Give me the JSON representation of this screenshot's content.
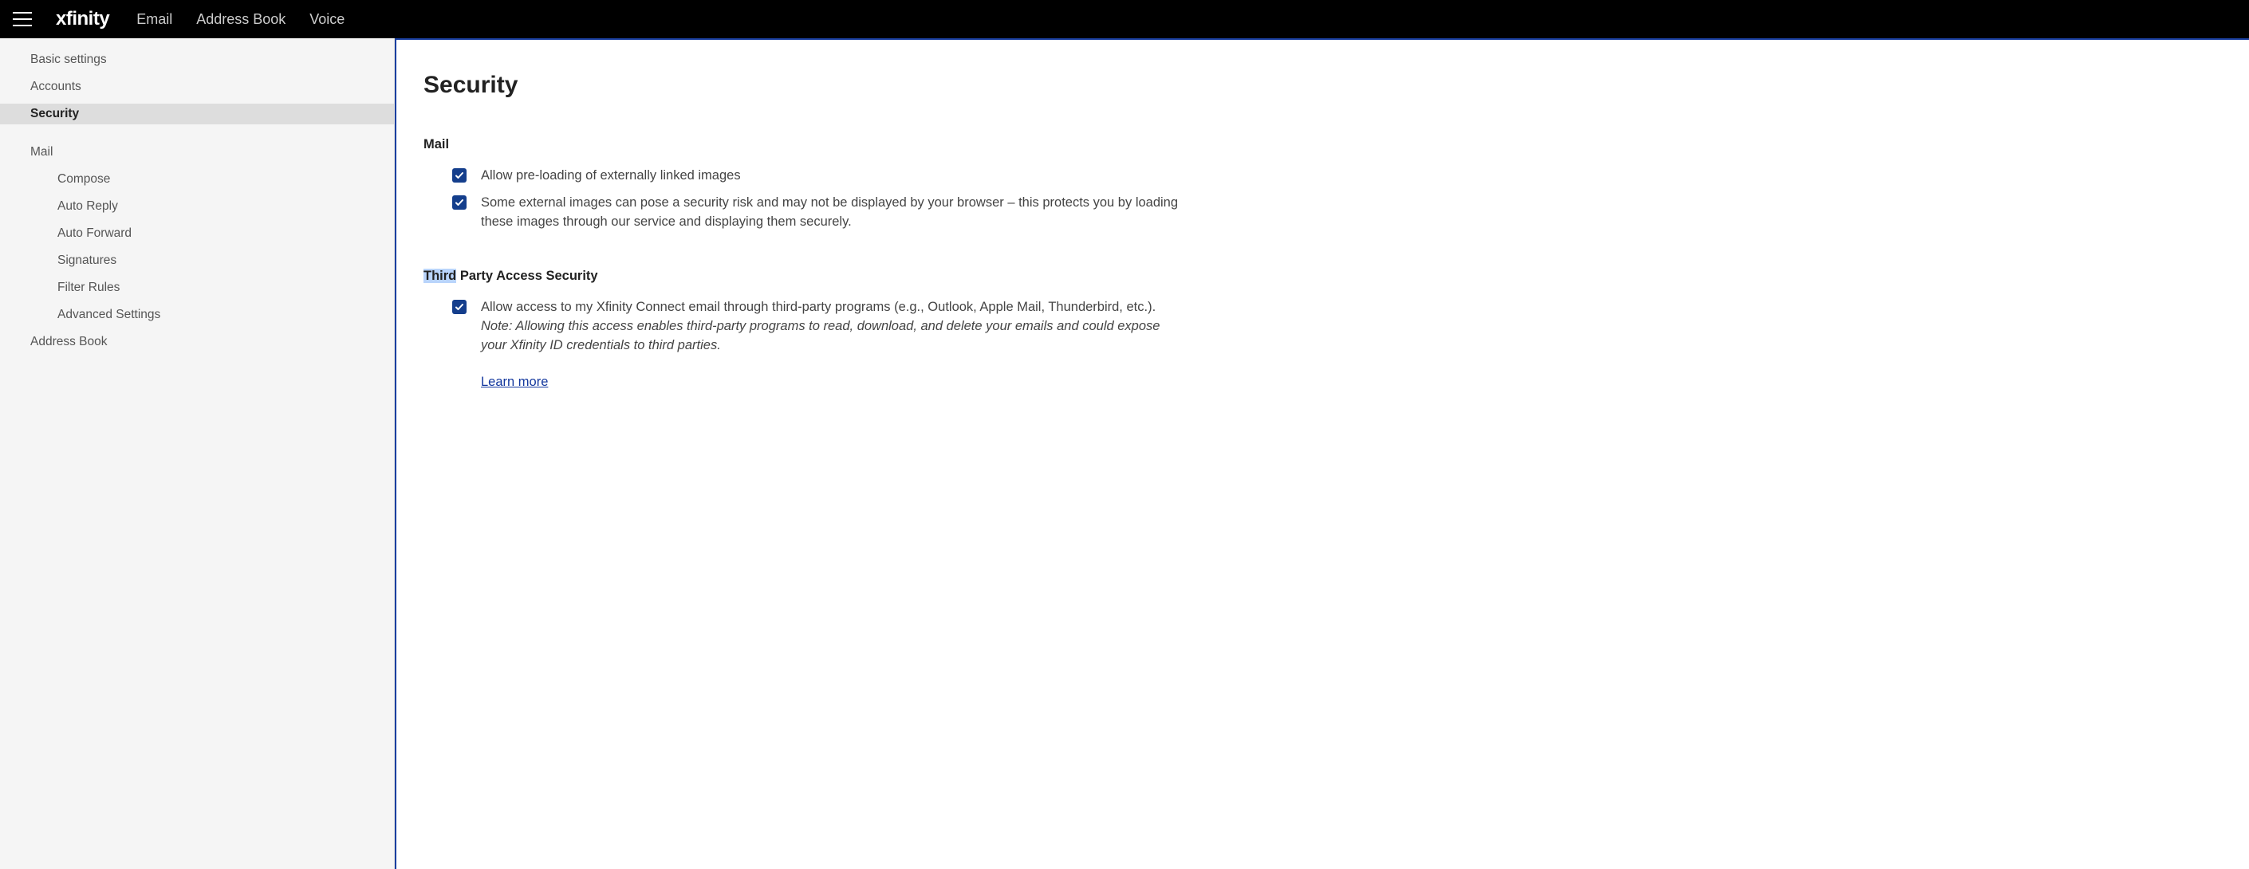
{
  "topbar": {
    "brand": "xfinity",
    "nav": [
      {
        "label": "Email"
      },
      {
        "label": "Address Book"
      },
      {
        "label": "Voice"
      }
    ]
  },
  "sidebar": {
    "items": [
      {
        "label": "Basic settings",
        "indent": 0,
        "selected": false
      },
      {
        "label": "Accounts",
        "indent": 0,
        "selected": false
      },
      {
        "label": "Security",
        "indent": 0,
        "selected": true
      },
      {
        "gap": true
      },
      {
        "label": "Mail",
        "indent": 0,
        "selected": false
      },
      {
        "label": "Compose",
        "indent": 1,
        "selected": false
      },
      {
        "label": "Auto Reply",
        "indent": 1,
        "selected": false
      },
      {
        "label": "Auto Forward",
        "indent": 1,
        "selected": false
      },
      {
        "label": "Signatures",
        "indent": 1,
        "selected": false
      },
      {
        "label": "Filter Rules",
        "indent": 1,
        "selected": false
      },
      {
        "label": "Advanced Settings",
        "indent": 1,
        "selected": false
      },
      {
        "label": "Address Book",
        "indent": 0,
        "selected": false
      }
    ]
  },
  "main": {
    "title": "Security",
    "sections": [
      {
        "heading_plain": "Mail",
        "heading_highlight": "",
        "heading_rest": "Mail",
        "options": [
          {
            "checked": true,
            "text": "Allow pre-loading of externally linked images",
            "note": ""
          },
          {
            "checked": true,
            "text": "Some external images can pose a security risk and may not be displayed by your browser – this protects you by loading these images through our service and displaying them securely.",
            "note": ""
          }
        ],
        "link": ""
      },
      {
        "heading_plain": "Third Party Access Security",
        "heading_highlight": "Third",
        "heading_rest": " Party Access Security",
        "options": [
          {
            "checked": true,
            "text": "Allow access to my Xfinity Connect email through third-party programs (e.g., Outlook, Apple Mail, Thunderbird, etc.). ",
            "note": "Note: Allowing this access enables third-party programs to read, download, and delete your emails and could expose your Xfinity ID credentials to third parties."
          }
        ],
        "link": "Learn more"
      }
    ]
  }
}
